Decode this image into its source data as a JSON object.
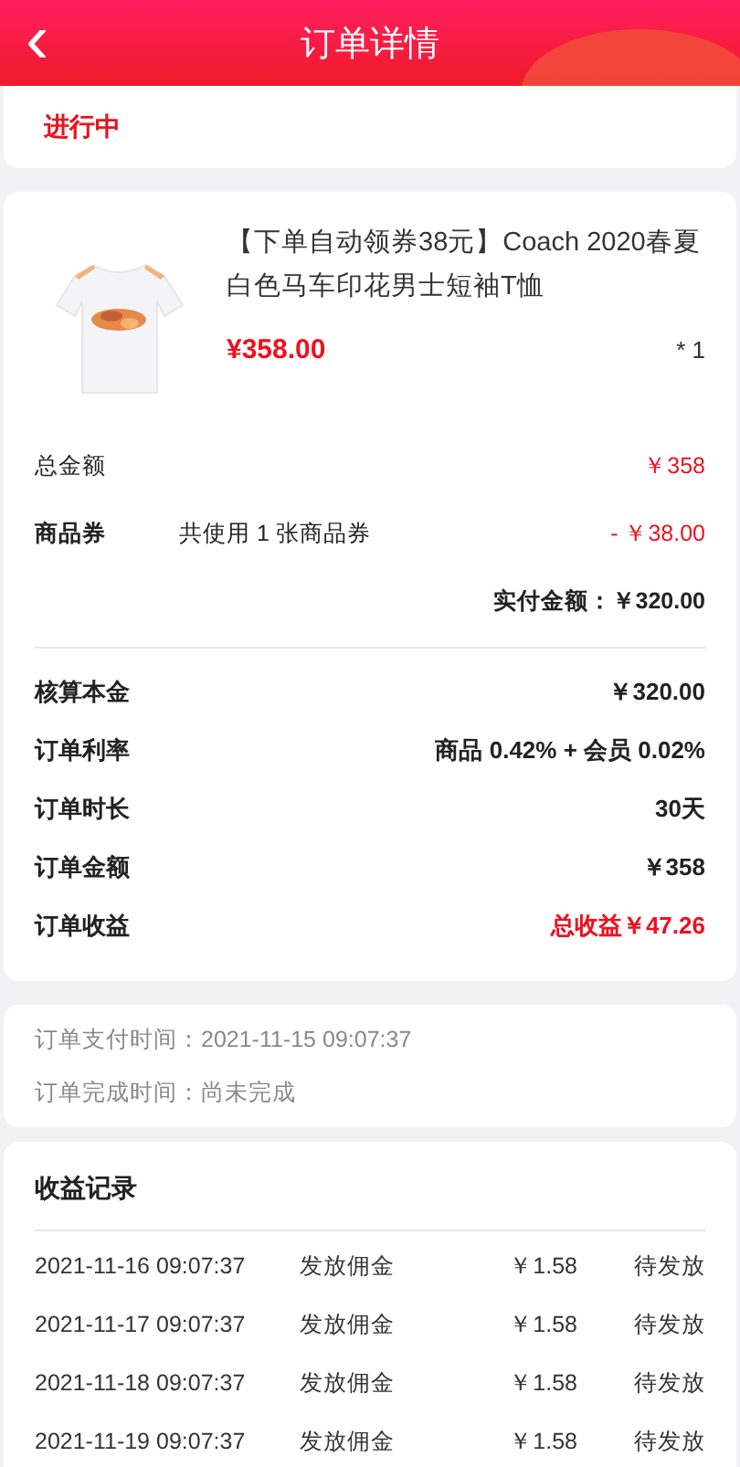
{
  "header": {
    "back_icon": "‹",
    "title": "订单详情"
  },
  "status": {
    "text": "进行中"
  },
  "product": {
    "title": "【下单自动领券38元】Coach 2020春夏白色马车印花男士短袖T恤",
    "price": "¥358.00",
    "quantity": "* 1"
  },
  "total": {
    "label": "总金额",
    "value": "￥358"
  },
  "coupon": {
    "label": "商品券",
    "note": "共使用 1 张商品券",
    "value": "- ￥38.00"
  },
  "paid": {
    "text": "实付金额：￥320.00"
  },
  "stats": [
    {
      "label": "核算本金",
      "value": "￥320.00",
      "highlight": false
    },
    {
      "label": "订单利率",
      "value": "商品 0.42% + 会员 0.02%",
      "highlight": false
    },
    {
      "label": "订单时长",
      "value": "30天",
      "highlight": false
    },
    {
      "label": "订单金额",
      "value": "￥358",
      "highlight": false
    },
    {
      "label": "订单收益",
      "value": "总收益￥47.26",
      "highlight": true
    }
  ],
  "times": [
    {
      "text": "订单支付时间：2021-11-15 09:07:37"
    },
    {
      "text": "订单完成时间：尚未完成"
    }
  ],
  "records": {
    "title": "收益记录",
    "rows": [
      {
        "time": "2021-11-16 09:07:37",
        "type": "发放佣金",
        "amount": "￥1.58",
        "status": "待发放"
      },
      {
        "time": "2021-11-17 09:07:37",
        "type": "发放佣金",
        "amount": "￥1.58",
        "status": "待发放"
      },
      {
        "time": "2021-11-18 09:07:37",
        "type": "发放佣金",
        "amount": "￥1.58",
        "status": "待发放"
      },
      {
        "time": "2021-11-19 09:07:37",
        "type": "发放佣金",
        "amount": "￥1.58",
        "status": "待发放"
      }
    ]
  }
}
